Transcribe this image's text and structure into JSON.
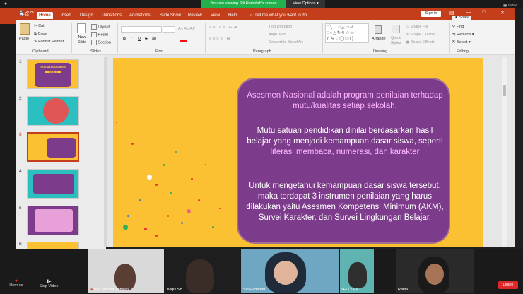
{
  "zoom": {
    "banner": "You are viewing Siti Hamidah's screen",
    "view_options": "View Options",
    "view_label": "View"
  },
  "tabs": [
    "File",
    "Home",
    "Insert",
    "Design",
    "Transitions",
    "Animations",
    "Slide Show",
    "Review",
    "View",
    "Help"
  ],
  "tell_me": "Tell me what you want to do",
  "sign_in": "Sign in",
  "share": "Share",
  "ribbon": {
    "clipboard": {
      "paste": "Paste",
      "cut": "Cut",
      "copy": "Copy",
      "format_painter": "Format Painter",
      "label": "Clipboard"
    },
    "slides": {
      "new_slide": "New Slide",
      "layout": "Layout",
      "reset": "Reset",
      "section": "Section",
      "label": "Slides"
    },
    "font": {
      "label": "Font",
      "bold": "B",
      "italic": "I",
      "underline": "U",
      "strike": "S",
      "shadow": "ab"
    },
    "paragraph": {
      "text_direction": "Text Direction",
      "align_text": "Align Text",
      "smartart": "Convert to SmartArt",
      "label": "Paragraph"
    },
    "drawing": {
      "arrange": "Arrange",
      "quick_styles": "Quick Styles",
      "shape_fill": "Shape Fill",
      "shape_outline": "Shape Outline",
      "shape_effects": "Shape Effects",
      "label": "Drawing"
    },
    "editing": {
      "find": "Find",
      "replace": "Replace",
      "select": "Select",
      "label": "Editing"
    }
  },
  "thumbnails": [
    {
      "num": "1",
      "title": "SOSIALISASI AKM",
      "sub": "Kelas 6"
    },
    {
      "num": "2"
    },
    {
      "num": "3"
    },
    {
      "num": "4"
    },
    {
      "num": "5"
    },
    {
      "num": "6"
    }
  ],
  "slide": {
    "p1": "Asesmen Nasional adalah program penilaian terhadap mutu/kualitas setiap sekolah.",
    "p2a": "Mutu satuan pendidikan dinilai berdasarkan hasil belajar yang menjadi kemampuan dasar siswa, seperti",
    "p2b": "literasi membaca, numerasi, dan karakter",
    "p3a": "Untuk mengetahui kemampuan dasar siswa tersebut, maka terdapat",
    "p3b": "3 instrumen penilaian yang harus dilakukan yaitu Asesmen Kompetensi Minimum (AKM), Survei Karakter, dan Survei Lingkungan Belajar."
  },
  "participants": [
    {
      "name": "Vita Siti Nur Fattaah"
    },
    {
      "name": "Bilqis SB"
    },
    {
      "name": "Siti Hamidah"
    },
    {
      "name": "SELLY.F.P"
    },
    {
      "name": "Rafila"
    }
  ],
  "controls": {
    "unmute": "Unmute",
    "stop_video": "Stop Video",
    "leave": "Leave"
  },
  "colors": {
    "ribbon": "#c43e1c",
    "slide_bg": "#fcc133",
    "card": "#7d3c8b",
    "zoom_green": "#22b14c",
    "leave": "#e02828"
  }
}
